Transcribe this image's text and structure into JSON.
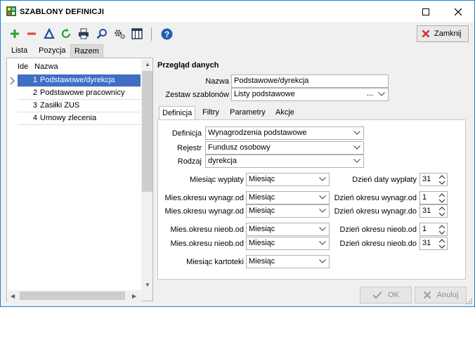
{
  "window": {
    "title": "SZABLONY DEFINICJI"
  },
  "toolbar": {
    "icons": [
      "add-icon",
      "remove-icon",
      "filter-icon",
      "refresh-icon",
      "print-icon",
      "search-icon",
      "settings-icon",
      "columns-icon",
      "help-icon"
    ],
    "close_label": "Zamknij"
  },
  "outer_tabs": [
    "Lista",
    "Pozycja",
    "Razem"
  ],
  "list": {
    "headers": {
      "id": "Ide",
      "name": "Nazwa"
    },
    "rows": [
      {
        "num": "1",
        "name": "Podstawowe/dyrekcja"
      },
      {
        "num": "2",
        "name": "Podstawowe pracownicy"
      },
      {
        "num": "3",
        "name": "Zasiłki ZUS"
      },
      {
        "num": "4",
        "name": "Umowy zlecenia"
      }
    ]
  },
  "overview": {
    "title": "Przegląd danych",
    "name_label": "Nazwa",
    "name_value": "Podstawowe/dyrekcja",
    "set_label": "Zestaw szablonów",
    "set_value": "Listy podstawowe",
    "set_dots": "..."
  },
  "inner_tabs": [
    "Definicja",
    "Filtry",
    "Parametry",
    "Akcje"
  ],
  "definition": {
    "definicja_label": "Definicja",
    "definicja_value": "Wynagrodzenia podstawowe",
    "rejestr_label": "Rejestr",
    "rejestr_value": "Fundusz osobowy",
    "rodzaj_label": "Rodzaj",
    "rodzaj_value": "dyrekcja",
    "rows": [
      {
        "left_label": "Miesiąc wypłaty",
        "left_value": "Miesiąc",
        "right_label": "Dzień daty wypłaty",
        "right_value": "31"
      },
      {
        "left_label": "Mies.okresu wynagr.od",
        "left_value": "Miesiąc",
        "right_label": "Dzień okresu wynagr.od",
        "right_value": "1"
      },
      {
        "left_label": "Mies.okresu wynagr.od",
        "left_value": "Miesiąc",
        "right_label": "Dzień okresu wynagr.do",
        "right_value": "31"
      },
      {
        "left_label": "Mies.okresu nieob.od",
        "left_value": "Miesiąc",
        "right_label": "Dzień okresu nieob.od",
        "right_value": "1"
      },
      {
        "left_label": "Mies.okresu nieob.od",
        "left_value": "Miesiąc",
        "right_label": "Dzień okresu nieob.do",
        "right_value": "31"
      }
    ],
    "kartoteki_label": "Miesiąc kartoteki",
    "kartoteki_value": "Miesiąc"
  },
  "footer": {
    "ok_label": "OK",
    "cancel_label": "Anuluj"
  }
}
